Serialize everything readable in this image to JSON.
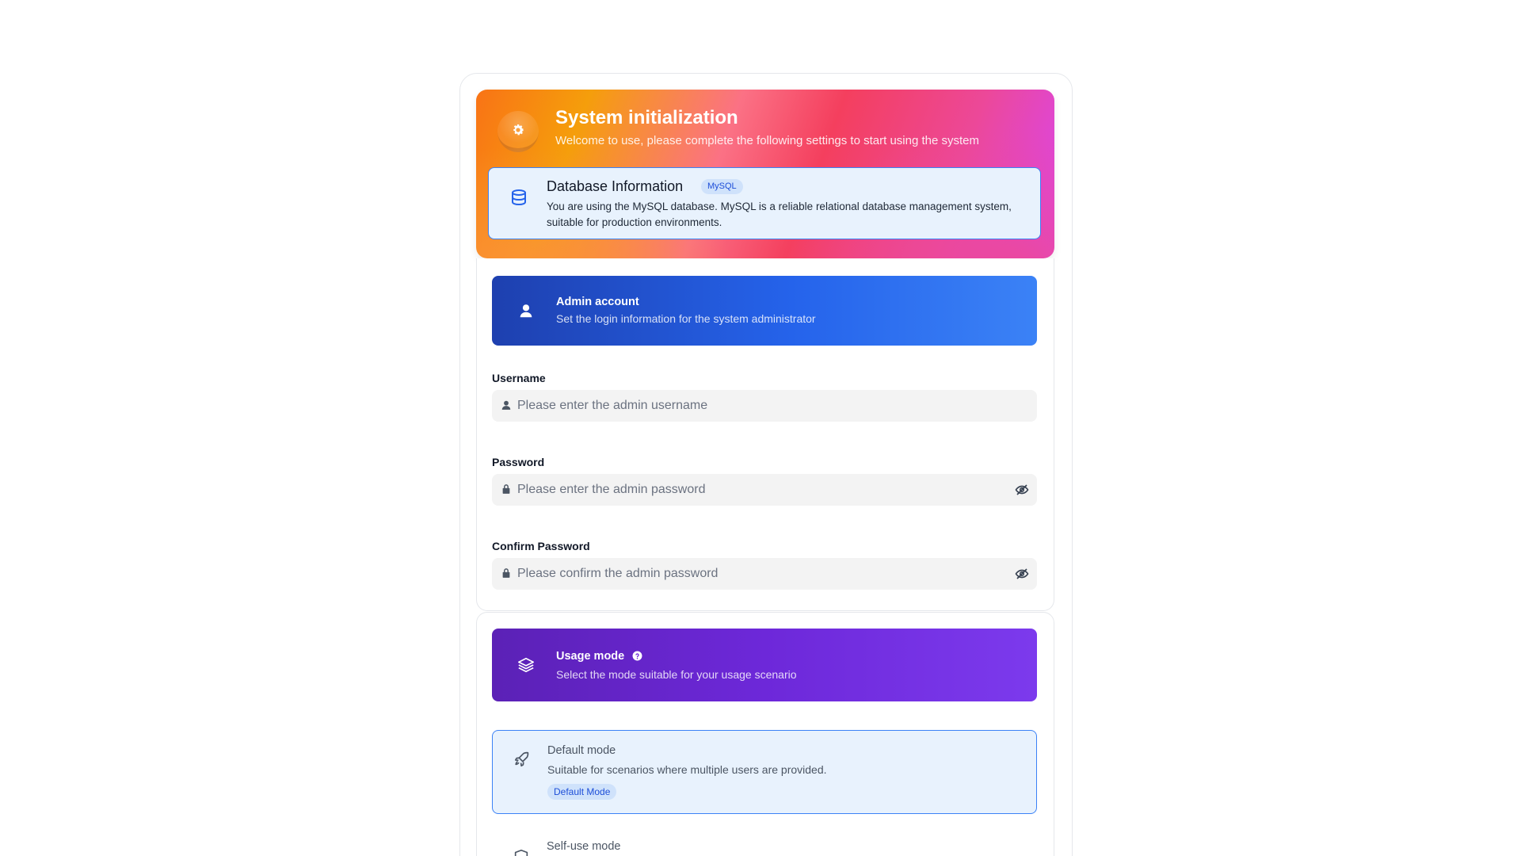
{
  "header": {
    "title": "System initialization",
    "subtitle": "Welcome to use, please complete the following settings to start using the system",
    "icon": "gear-icon"
  },
  "database": {
    "title": "Database Information",
    "badge": "MySQL",
    "description": "You are using the MySQL database. MySQL is a reliable relational database management system, suitable for production environments.",
    "icon": "database-icon"
  },
  "admin": {
    "title": "Admin account",
    "subtitle": "Set the login information for the system administrator",
    "icon": "user-icon",
    "fields": {
      "username": {
        "label": "Username",
        "placeholder": "Please enter the admin username",
        "value": ""
      },
      "password": {
        "label": "Password",
        "placeholder": "Please enter the admin password",
        "value": ""
      },
      "confirm": {
        "label": "Confirm Password",
        "placeholder": "Please confirm the admin password",
        "value": ""
      }
    }
  },
  "usage_mode": {
    "title": "Usage mode",
    "subtitle": "Select the mode suitable for your usage scenario",
    "icon": "layers-icon",
    "options": [
      {
        "title": "Default mode",
        "description": "Suitable for scenarios where multiple users are provided.",
        "badge": "Default Mode",
        "icon": "rocket-icon",
        "selected": true
      },
      {
        "title": "Self-use mode",
        "icon": "shield-icon",
        "selected": false
      }
    ]
  },
  "colors": {
    "accent_blue": "#3b82f6",
    "admin_banner": "#2563eb",
    "mode_banner": "#6d28d9",
    "selected_bg": "#e8f2fd"
  }
}
